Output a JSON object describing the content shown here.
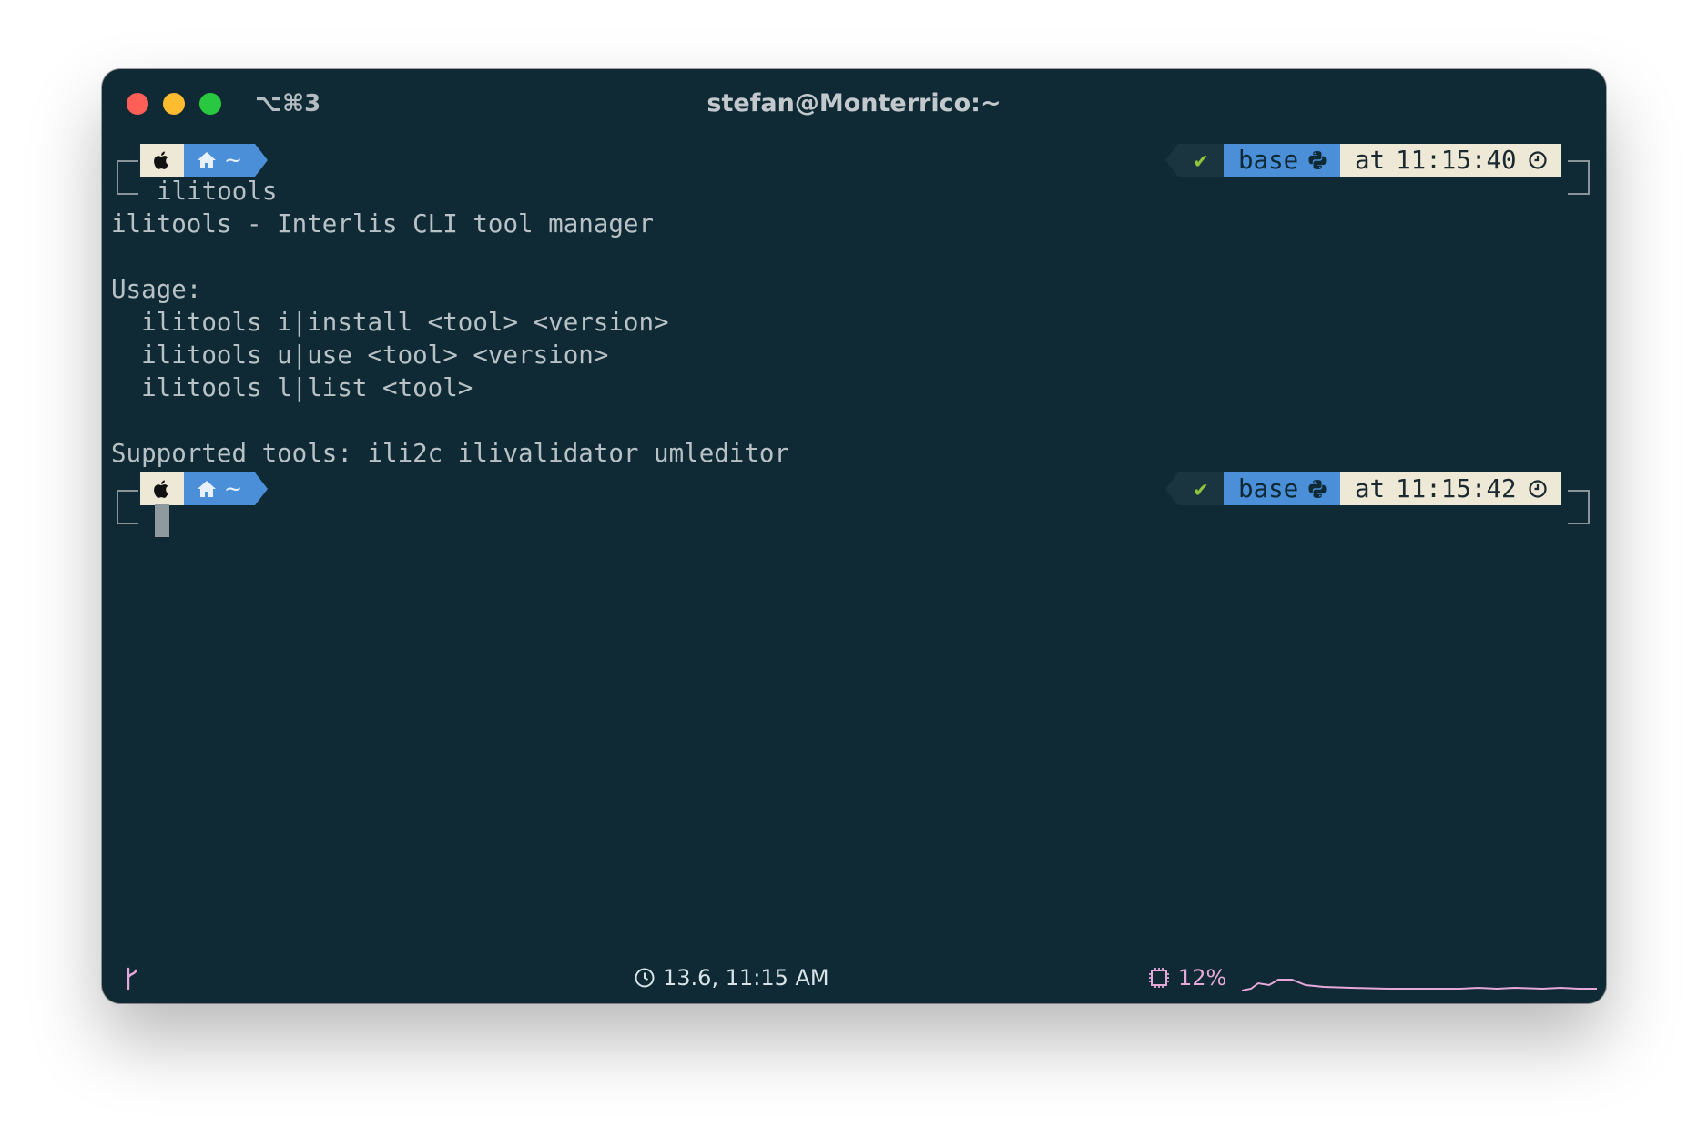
{
  "window": {
    "title": "stefan@Monterrico:~",
    "shortcut": "⌥⌘3"
  },
  "prompt": {
    "dir_label": "~",
    "env_label": "base",
    "time_prefix": "at",
    "first_time": "11:15:40",
    "second_time": "11:15:42",
    "status_ok": "✔"
  },
  "terminal": {
    "command": "ilitools",
    "output": [
      "ilitools - Interlis CLI tool manager",
      "",
      "Usage:",
      "  ilitools i|install <tool> <version>",
      "  ilitools u|use <tool> <version>",
      "  ilitools l|list <tool>",
      "",
      "Supported tools: ili2c ilivalidator umleditor"
    ]
  },
  "statusbar": {
    "clock": "13.6, 11:15 AM",
    "cpu": "12%"
  },
  "colors": {
    "background": "#0f2a35",
    "accent_blue": "#4a8fd8",
    "cream": "#eee8d6",
    "ok_green": "#8ec33c",
    "cpu_pink": "#e6a8d8"
  },
  "icons": [
    "apple-icon",
    "home-icon",
    "check-icon",
    "python-icon",
    "clock-icon",
    "git-branch-icon",
    "cpu-icon"
  ]
}
